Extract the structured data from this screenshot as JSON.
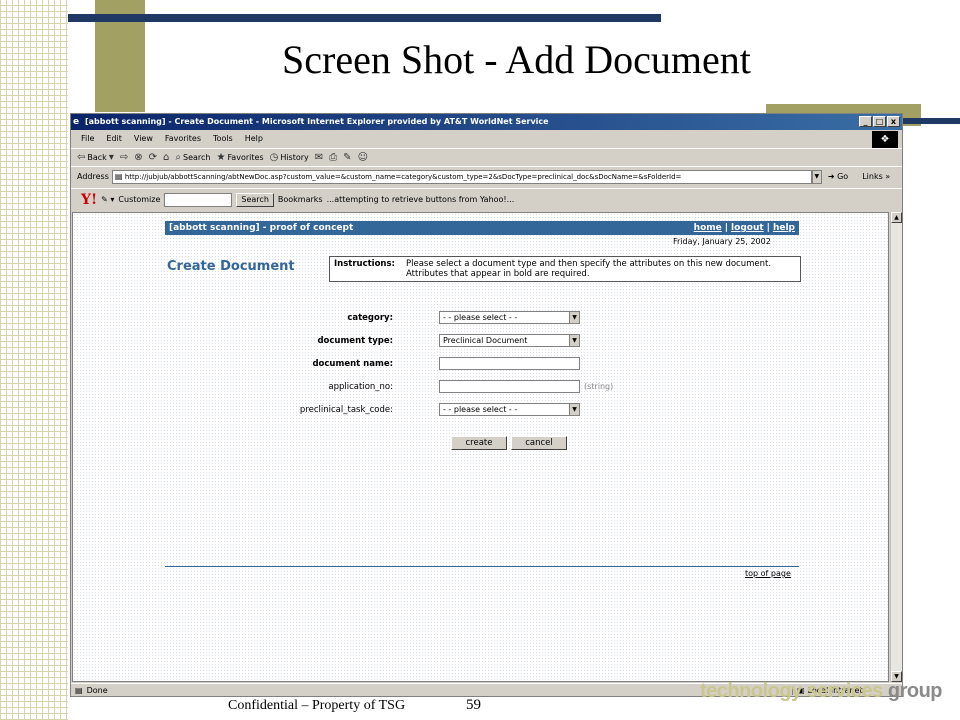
{
  "slide": {
    "title": "Screen Shot - Add Document",
    "footer_text": "Confidential – Property of TSG",
    "page_number": "59",
    "logo_text": "technology services",
    "logo_tail": " group"
  },
  "window": {
    "title": "[abbott scanning] - Create Document - Microsoft Internet Explorer provided by AT&T WorldNet Service",
    "buttons": [
      "_",
      "□",
      "x"
    ]
  },
  "menu": [
    "File",
    "Edit",
    "View",
    "Favorites",
    "Tools",
    "Help"
  ],
  "toolbar": {
    "back": "Back",
    "search": "Search",
    "favorites": "Favorites",
    "history": "History"
  },
  "address": {
    "label": "Address",
    "url": "http://jubjub/abbottScanning/abtNewDoc.asp?custom_value=&custom_name=category&custom_type=2&sDocType=preclinical_doc&sDocName=&sFolderId=",
    "go": "Go",
    "links": "Links"
  },
  "yahoo_bar": {
    "customize": "Customize",
    "search_button": "Search",
    "bookmarks": "Bookmarks",
    "status": "...attempting to retrieve buttons from Yahoo!..."
  },
  "status_bar": {
    "left": "Done",
    "zone": "Local intranet"
  },
  "page": {
    "header_title": "[abbott scanning] - proof of concept",
    "nav": {
      "home": "home",
      "logout": "logout",
      "help": "help",
      "sep": "|"
    },
    "date": "Friday, January 25, 2002",
    "heading": "Create Document",
    "instructions_label": "Instructions:",
    "instructions_text": "Please select a document type and then specify the attributes on this new document.  Attributes that appear in bold are required.",
    "form": {
      "category_label": "category:",
      "category_value": "- - please select - -",
      "doctype_label": "document type:",
      "doctype_value": "Preclinical Document",
      "docname_label": "document name:",
      "docname_value": "",
      "appno_label": "application_no:",
      "appno_value": "",
      "appno_hint": "(string)",
      "taskcode_label": "preclinical_task_code:",
      "taskcode_value": "- - please select - -"
    },
    "create_button": "create",
    "cancel_button": "cancel",
    "top_of_page": "top of page"
  }
}
